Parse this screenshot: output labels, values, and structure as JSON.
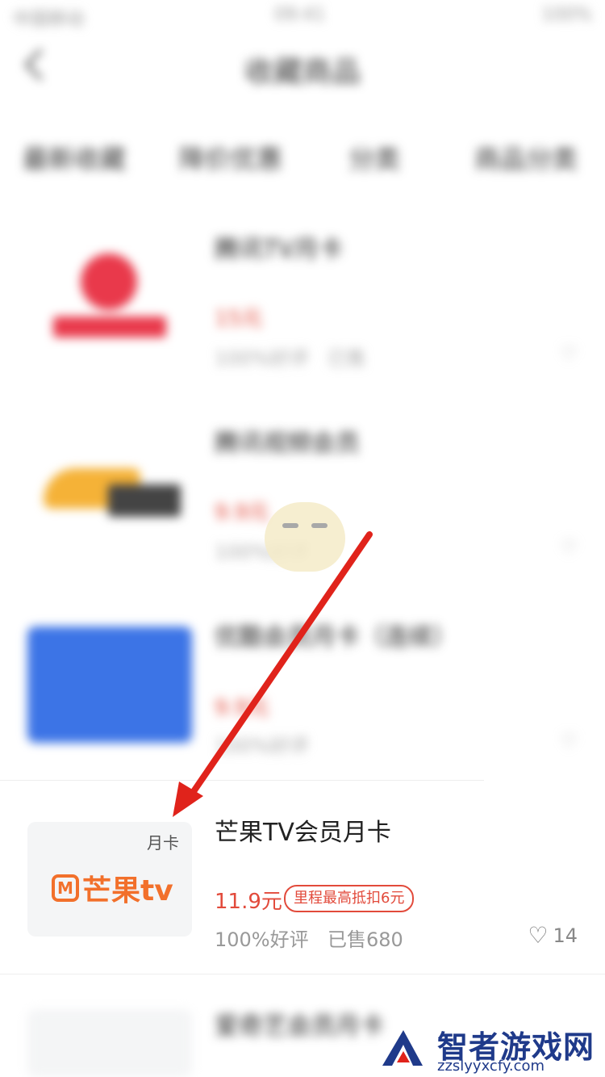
{
  "status_bar": {
    "carrier": "中国移动",
    "time": "09:41",
    "battery": "100%"
  },
  "nav": {
    "title": "收藏商品"
  },
  "tabs": [
    "最新收藏",
    "降价优惠",
    "分类",
    "商品分类"
  ],
  "items": [
    {
      "title": "腾讯TV月卡",
      "price": "15元",
      "rating": "100%好评",
      "sold": "已售",
      "favs": ""
    },
    {
      "title": "腾讯视频会员",
      "price": "9.9元",
      "rating": "100%好评",
      "sold": "已售",
      "favs": ""
    },
    {
      "title": "优酷会员月卡（连续）",
      "price": "9.9元",
      "rating": "100%好评",
      "sold": "已售",
      "favs": ""
    }
  ],
  "mango": {
    "tag": "月卡",
    "logo_text": "芒果tv",
    "title": "芒果TV会员月卡",
    "price": "11.9元",
    "badge": "里程最高抵扣6元",
    "rating": "100%好评",
    "sold": "已售680",
    "favs": "14"
  },
  "next_item": {
    "title": "爱奇艺会员月卡"
  },
  "watermark": {
    "title": "智者游戏网",
    "url": "zzslyyxcfy.com"
  },
  "colors": {
    "price_red": "#e24a3b",
    "mango_orange": "#f2702b",
    "arrow_red": "#e0231b"
  }
}
